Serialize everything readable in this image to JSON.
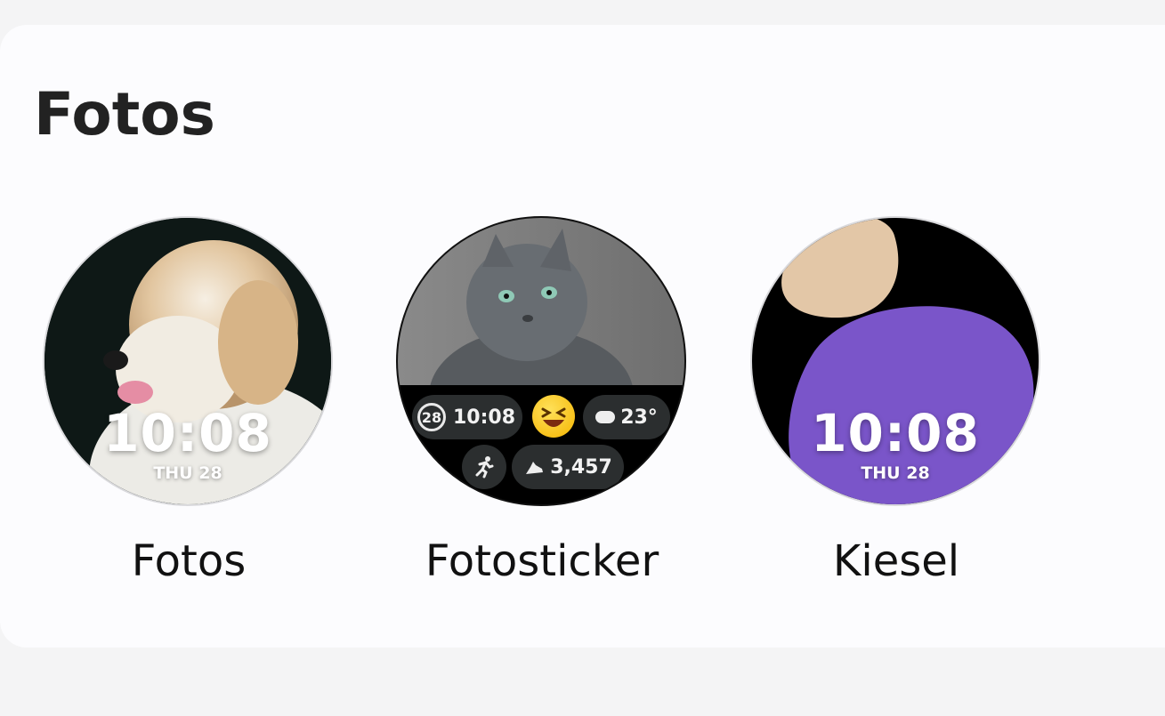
{
  "section": {
    "title": "Fotos"
  },
  "faces": [
    {
      "label": "Fotos",
      "time": "10:08",
      "date": "THU 28"
    },
    {
      "label": "Fotosticker",
      "complications": {
        "date_num": "28",
        "time": "10:08",
        "weather": "23°",
        "steps": "3,457"
      }
    },
    {
      "label": "Kiesel",
      "time": "10:08",
      "date": "THU 28"
    }
  ],
  "colors": {
    "background": "#f4f4f5",
    "card": "#fcfcfe",
    "kiesel_purple": "#7a55c9",
    "kiesel_beige": "#e3c7a7",
    "complication_bg": "#2b2e2f"
  },
  "icons": [
    "cloud-sun-icon",
    "running-icon",
    "shoe-icon",
    "laughing-emoji-icon"
  ]
}
